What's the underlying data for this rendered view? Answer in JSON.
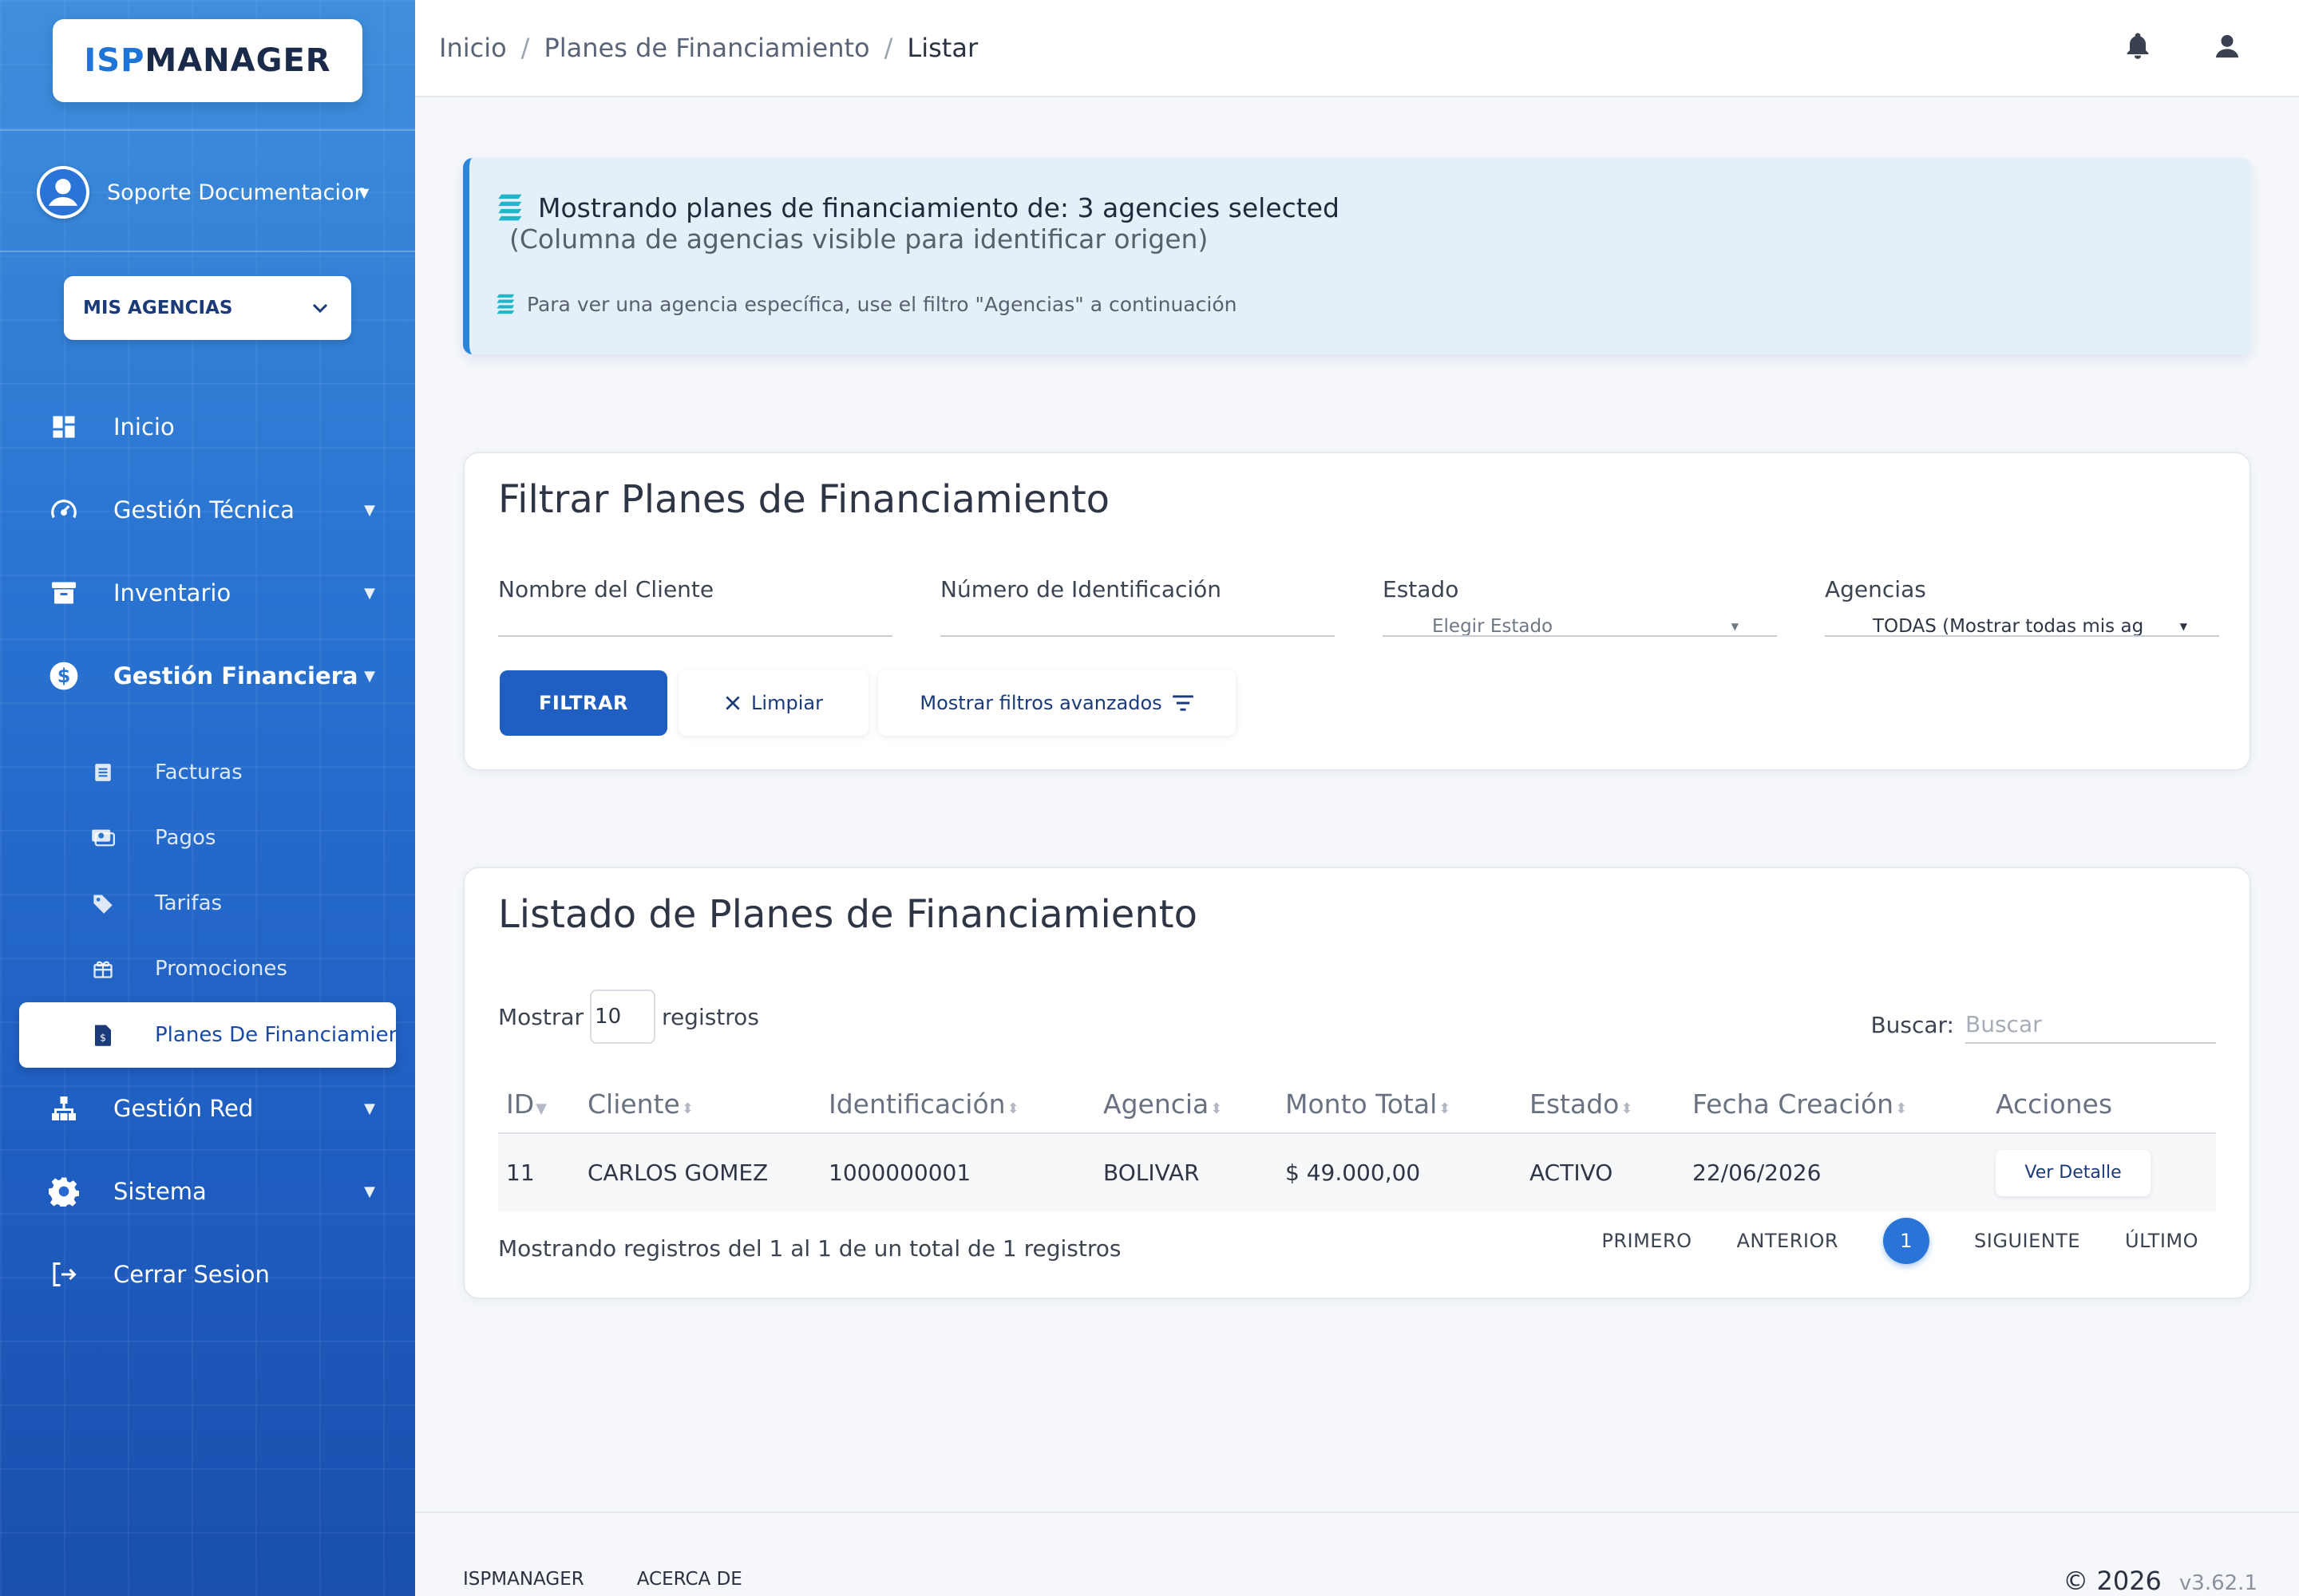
{
  "sidebar": {
    "logo_isp": "ISP",
    "logo_manager": "MANAGER",
    "user_name": "Soporte Documentacion",
    "agency_select": "MIS AGENCIAS",
    "nav": [
      {
        "label": "Inicio",
        "icon": "dashboard-icon"
      },
      {
        "label": "Gestión Técnica",
        "icon": "speedometer-icon"
      },
      {
        "label": "Inventario",
        "icon": "archive-icon"
      },
      {
        "label": "Gestión Financiera",
        "icon": "dollar-icon"
      },
      {
        "label": "Gestión Red",
        "icon": "network-icon"
      },
      {
        "label": "Sistema",
        "icon": "gear-icon"
      },
      {
        "label": "Cerrar Sesion",
        "icon": "logout-icon"
      }
    ],
    "sub_items": [
      {
        "label": "Facturas",
        "icon": "invoice-icon"
      },
      {
        "label": "Pagos",
        "icon": "payments-icon"
      },
      {
        "label": "Tarifas",
        "icon": "tag-icon"
      },
      {
        "label": "Promociones",
        "icon": "gift-icon"
      },
      {
        "label": "Planes De Financiamiento",
        "icon": "document-dollar-icon"
      }
    ]
  },
  "topbar": {
    "breadcrumb": [
      "Inicio",
      "Planes de Financiamiento",
      "Listar"
    ],
    "separator": "/"
  },
  "alert": {
    "line1": "Mostrando planes de financiamiento de: 3 agencies selected",
    "line2": "(Columna de agencias visible para identificar origen)",
    "line3": "Para ver una agencia específica, use el filtro \"Agencias\" a continuación"
  },
  "filter": {
    "title": "Filtrar Planes de Financiamiento",
    "client_label": "Nombre del Cliente",
    "id_label": "Número de Identificación",
    "status_label": "Estado",
    "status_placeholder": "Elegir Estado",
    "agencies_label": "Agencias",
    "agencies_value": "TODAS (Mostrar todas mis ag",
    "filter_button": "FILTRAR",
    "clear_button": "Limpiar",
    "advanced_button": "Mostrar filtros avanzados"
  },
  "listing": {
    "title": "Listado de Planes de Financiamiento",
    "show_label": "Mostrar",
    "page_size": "10",
    "records_label": "registros",
    "search_label": "Buscar:",
    "search_placeholder": "Buscar",
    "columns": [
      "ID",
      "Cliente",
      "Identificación",
      "Agencia",
      "Monto Total",
      "Estado",
      "Fecha Creación",
      "Acciones"
    ],
    "rows": [
      {
        "id": "11",
        "cliente": "CARLOS GOMEZ",
        "identificacion": "1000000001",
        "agencia": "BOLIVAR",
        "monto": "$ 49.000,00",
        "estado": "ACTIVO",
        "fecha": "22/06/2026",
        "accion": "Ver Detalle"
      }
    ],
    "info": "Mostrando registros del 1 al 1 de un total de 1 registros",
    "pager": {
      "first": "PRIMERO",
      "prev": "ANTERIOR",
      "current": "1",
      "next": "SIGUIENTE",
      "last": "ÚLTIMO"
    }
  },
  "footer": {
    "links": [
      "ISPMANAGER",
      "ACERCA DE"
    ],
    "copyright": "© 2026",
    "version": "v3.62.1"
  },
  "colors": {
    "primary": "#1f5fc2",
    "accent": "#2a74d8",
    "alert_bg": "#e3f0fa",
    "alert_icon": "#20b6c8"
  }
}
